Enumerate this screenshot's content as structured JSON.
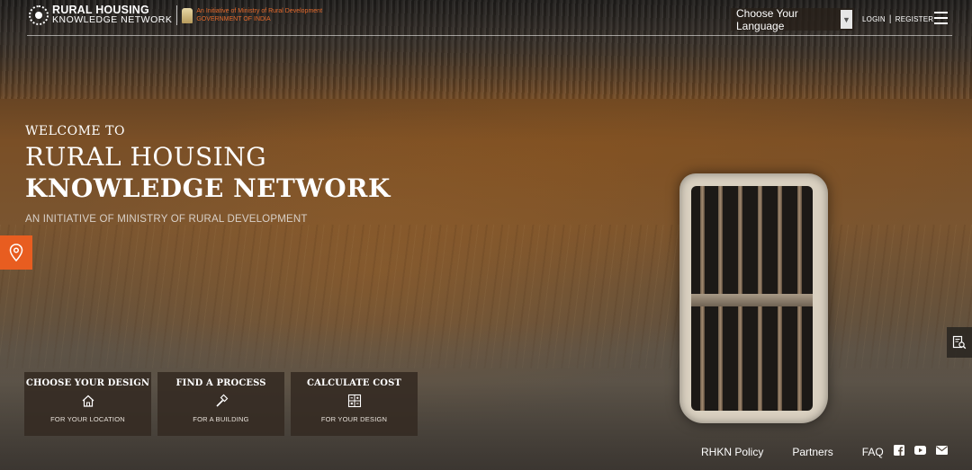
{
  "header": {
    "logo_line1": "RURAL HOUSING",
    "logo_line2": "KNOWLEDGE NETWORK",
    "initiative_line1": "An Initiative of Ministry of Rural Development",
    "initiative_line2": "GOVERNMENT OF INDIA",
    "language_select": "Choose Your Language",
    "login": "LOGIN",
    "separator": "|",
    "register": "REGISTER"
  },
  "hero": {
    "welcome": "WELCOME TO",
    "title_line1": "RURAL HOUSING",
    "title_line2": "KNOWLEDGE NETWORK",
    "tagline": "AN INITIATIVE OF MINISTRY OF RURAL DEVELOPMENT"
  },
  "cards": [
    {
      "title": "CHOOSE YOUR DESIGN",
      "icon": "house-icon",
      "subtitle": "FOR YOUR LOCATION"
    },
    {
      "title": "FIND A PROCESS",
      "icon": "hammer-icon",
      "subtitle": "FOR A BUILDING"
    },
    {
      "title": "CALCULATE COST",
      "icon": "calculator-icon",
      "subtitle": "FOR YOUR DESIGN"
    }
  ],
  "footer": {
    "links": [
      "RHKN Policy",
      "Partners",
      "FAQ"
    ],
    "social": [
      "facebook-icon",
      "youtube-icon",
      "mail-icon"
    ]
  },
  "colors": {
    "accent": "#e85d20",
    "initiative_text": "#e56a2c"
  }
}
